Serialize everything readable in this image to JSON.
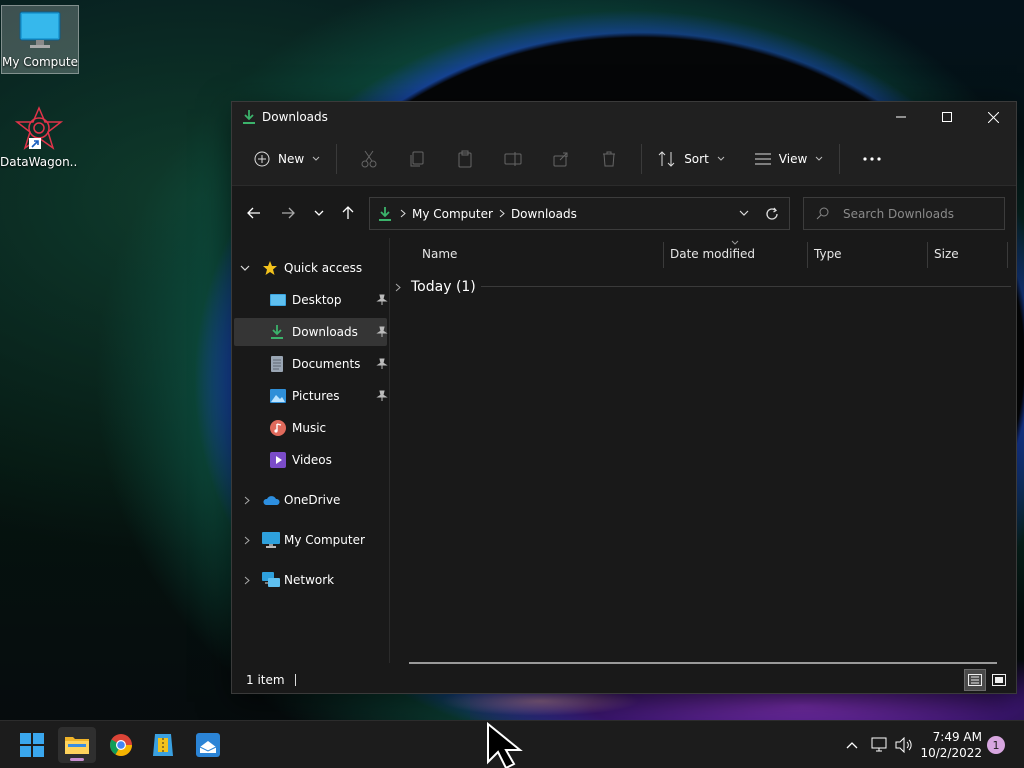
{
  "desktop": {
    "icons": [
      {
        "label": "My Computer",
        "icon": "computer-icon",
        "selected": true
      },
      {
        "label": "DataWagon...",
        "icon": "datawagon-shortcut-icon",
        "selected": false
      }
    ]
  },
  "window": {
    "title": "Downloads",
    "title_icon": "download-icon",
    "controls": [
      "minimize",
      "maximize",
      "close"
    ]
  },
  "toolbar": {
    "new_label": "New",
    "sort_label": "Sort",
    "view_label": "View",
    "disabled_actions": [
      "cut",
      "copy",
      "paste",
      "rename",
      "share",
      "delete"
    ],
    "more_label": "More options"
  },
  "address": {
    "crumbs": [
      "My Computer",
      "Downloads"
    ],
    "search_placeholder": "Search Downloads"
  },
  "nav": {
    "quick_access_label": "Quick access",
    "items": [
      {
        "label": "Desktop",
        "pinned": true
      },
      {
        "label": "Downloads",
        "pinned": true,
        "selected": true
      },
      {
        "label": "Documents",
        "pinned": true
      },
      {
        "label": "Pictures",
        "pinned": true
      },
      {
        "label": "Music",
        "pinned": false
      },
      {
        "label": "Videos",
        "pinned": false
      }
    ],
    "roots": [
      {
        "label": "OneDrive"
      },
      {
        "label": "My Computer"
      },
      {
        "label": "Network"
      }
    ]
  },
  "content": {
    "columns": [
      "Name",
      "Date modified",
      "Type",
      "Size"
    ],
    "groups": [
      {
        "label": "Today (1)",
        "expanded": false
      }
    ]
  },
  "status": {
    "item_count": "1 item"
  },
  "taskbar": {
    "apps": [
      "start",
      "file-explorer",
      "chrome",
      "app-store-like",
      "mail-like"
    ],
    "clock_time": "7:49 AM",
    "clock_date": "10/2/2022",
    "notification_count": "1"
  },
  "colors": {
    "window_bg": "#191919",
    "toolbar_bg": "#202020",
    "accent_green": "#3bb36b",
    "taskbar_bg": "#1c1c1c"
  }
}
